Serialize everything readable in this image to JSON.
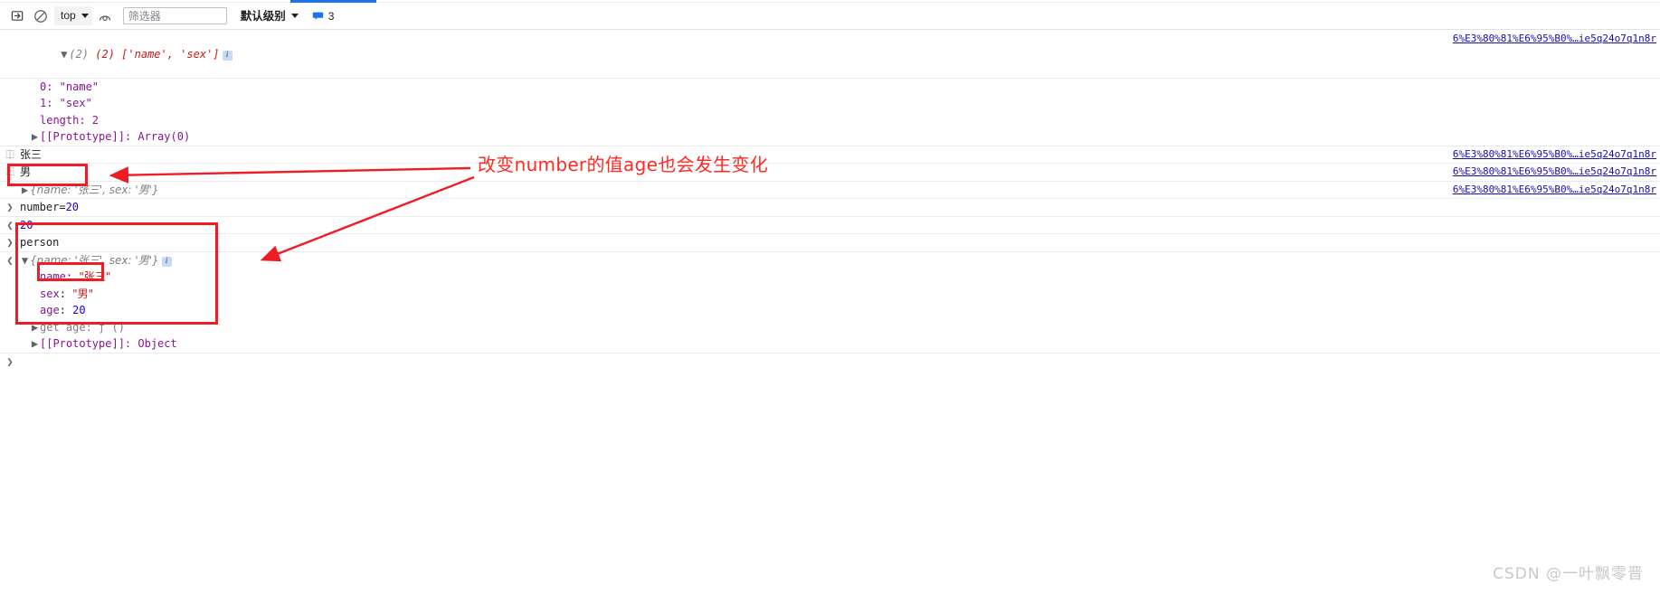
{
  "tabstrip": {
    "active_tab_indicator": "console-tab"
  },
  "toolbar": {
    "clear_console_title": "clear-console",
    "no_entry_title": "no-entry",
    "context_label": "top",
    "eye_title": "live-expressions",
    "filter_placeholder": "筛选器",
    "filter_value": "",
    "level_label": "默认级别",
    "message_count": "3"
  },
  "console": {
    "rows": [
      {
        "id": "array-header",
        "prefix": "▼ ",
        "text": "(2) ['name', 'sex']",
        "badge": "i",
        "source": "6%E3%80%81%E6%95%B0%…ie5q24o7q1n8r"
      },
      {
        "id": "array-item-0",
        "text": "0: \"name\""
      },
      {
        "id": "array-item-1",
        "text": "1: \"sex\""
      },
      {
        "id": "array-length",
        "text": "length: 2"
      },
      {
        "id": "array-prototype",
        "text": "[[Prototype]]: Array(0)"
      },
      {
        "id": "log-zhangsan",
        "text": "张三",
        "source": "6%E3%80%81%E6%95%B0%…ie5q24o7q1n8r"
      },
      {
        "id": "log-nan",
        "text": "男",
        "source": "6%E3%80%81%E6%95%B0%…ie5q24o7q1n8r"
      },
      {
        "id": "log-object-collapsed",
        "text": "{name: '张三', sex: '男'}",
        "source": "6%E3%80%81%E6%95%B0%…ie5q24o7q1n8r"
      },
      {
        "id": "input-number",
        "text": "number=20"
      },
      {
        "id": "output-20",
        "text": "20"
      },
      {
        "id": "input-person",
        "text": "person"
      },
      {
        "id": "person-header",
        "text": "{name: '张三', sex: '男'}",
        "badge": "i"
      },
      {
        "id": "person-name",
        "key": "name",
        "value": "\"张三\""
      },
      {
        "id": "person-sex",
        "key": "sex",
        "value": "\"男\""
      },
      {
        "id": "person-age",
        "key": "age",
        "value": "20"
      },
      {
        "id": "person-get-age",
        "text": "get age: ƒ ()"
      },
      {
        "id": "person-prototype",
        "text": "[[Prototype]]: Object"
      },
      {
        "id": "final-prompt",
        "text": ""
      }
    ]
  },
  "annotation": {
    "note_text": "改变number的值age也会发生变化",
    "color": "#ff2a22",
    "box_number_label": "number=20",
    "box_person_label": "person-object",
    "box_age_label": "age: 20"
  },
  "watermark": {
    "text": "CSDN @一叶飘零晋"
  }
}
